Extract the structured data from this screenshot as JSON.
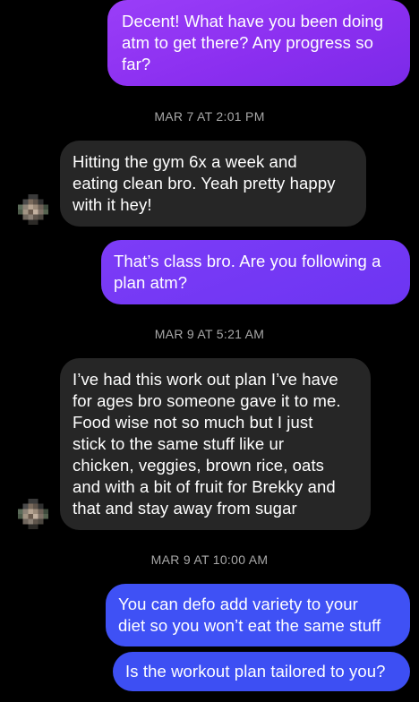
{
  "conversation": {
    "messages": [
      {
        "direction": "outgoing",
        "text": "Decent! What have you been doing\natm to get there? Any progress so\nfar?"
      },
      {
        "direction": "incoming",
        "text": "Hitting the gym 6x a week and\neating clean bro. Yeah pretty happy\nwith it hey!"
      },
      {
        "direction": "outgoing",
        "text": "That’s class bro. Are you following a\nplan atm?"
      },
      {
        "direction": "incoming",
        "text": "I’ve had this work out plan I’ve have\nfor ages bro someone gave it to me.\nFood wise not so much but I just\nstick to the same stuff like ur\nchicken, veggies, brown rice, oats\nand with a bit of fruit for Brekky and\nthat and stay away from sugar"
      },
      {
        "direction": "outgoing",
        "text": "You can defo add variety to your\ndiet so you won’t eat the same stuff"
      },
      {
        "direction": "outgoing",
        "text": "Is the workout plan tailored to you?"
      }
    ],
    "timestamps": [
      "MAR 7 AT 2:01 PM",
      "MAR 9 AT 5:21 AM",
      "MAR 9 AT 10:00 AM"
    ]
  },
  "colors": {
    "background": "#000000",
    "incoming_bubble": "#262626",
    "outgoing_purple": "#8b2ff0",
    "outgoing_violet": "#6c35f2",
    "outgoing_blue": "#3f51f5",
    "timestamp_text": "#a8a8a8"
  },
  "avatar": {
    "icon": "pixelated-avatar-icon"
  }
}
